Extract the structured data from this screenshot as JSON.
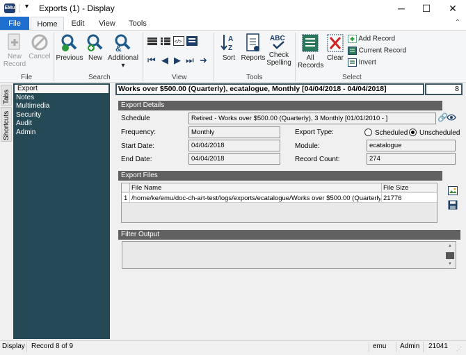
{
  "window": {
    "app_icon_text": "EMu",
    "title": "Exports (1) - Display",
    "minimize": "─",
    "maximize": "☐",
    "close": "✕"
  },
  "ribbon_tabs": [
    "File",
    "Home",
    "Edit",
    "View",
    "Tools"
  ],
  "ribbon": {
    "file_group": {
      "label": "File",
      "new_record": [
        "New",
        "Record"
      ],
      "cancel": "Cancel"
    },
    "search_group": {
      "label": "Search",
      "previous": "Previous",
      "new": "New",
      "additional": "Additional"
    },
    "view_group": {
      "label": "View"
    },
    "tools_group": {
      "label": "Tools",
      "sort": "Sort",
      "reports": "Reports",
      "check_spelling": [
        "Check",
        "Spelling"
      ]
    },
    "select_group": {
      "label": "Select",
      "all_records": [
        "All",
        "Records"
      ],
      "clear": "Clear",
      "add_record": "Add Record",
      "current_record": "Current Record",
      "invert": "Invert"
    }
  },
  "side_tabs": {
    "tabs": "Tabs",
    "shortcuts": "Shortcuts"
  },
  "nav": [
    "Export",
    "Notes",
    "Multimedia",
    "Security",
    "Audit",
    "Admin"
  ],
  "record": {
    "title": "Works over $500.00 (Quarterly), ecatalogue, Monthly [04/04/2018 - 04/04/2018]",
    "number": "8"
  },
  "export_details": {
    "header": "Export Details",
    "schedule_label": "Schedule",
    "schedule_value": "Retired - Works over $500.00 (Quarterly), 3 Monthly [01/01/2010 - ]",
    "frequency_label": "Frequency:",
    "frequency_value": "Monthly",
    "start_date_label": "Start Date:",
    "start_date_value": "04/04/2018",
    "end_date_label": "End Date:",
    "end_date_value": "04/04/2018",
    "export_type_label": "Export Type:",
    "scheduled_label": "Scheduled",
    "unscheduled_label": "Unscheduled",
    "module_label": "Module:",
    "module_value": "ecatalogue",
    "record_count_label": "Record Count:",
    "record_count_value": "274"
  },
  "export_files": {
    "header": "Export Files",
    "columns": [
      "File Name",
      "File Size"
    ],
    "rows": [
      {
        "index": "1",
        "file_name": "/home/ke/emu/doc-ch-art-test/logs/exports/ecatalogue/Works over $500.00 (Quarterly)/...",
        "file_size": "21776"
      }
    ]
  },
  "filter_output": {
    "header": "Filter Output"
  },
  "status": {
    "mode": "Display",
    "record": "Record 8 of 9",
    "user": "emu",
    "group": "Admin",
    "count": "21041"
  },
  "colors": {
    "accent": "#1e6fd0",
    "nav_bg": "#254a55",
    "section_header": "#616161"
  }
}
